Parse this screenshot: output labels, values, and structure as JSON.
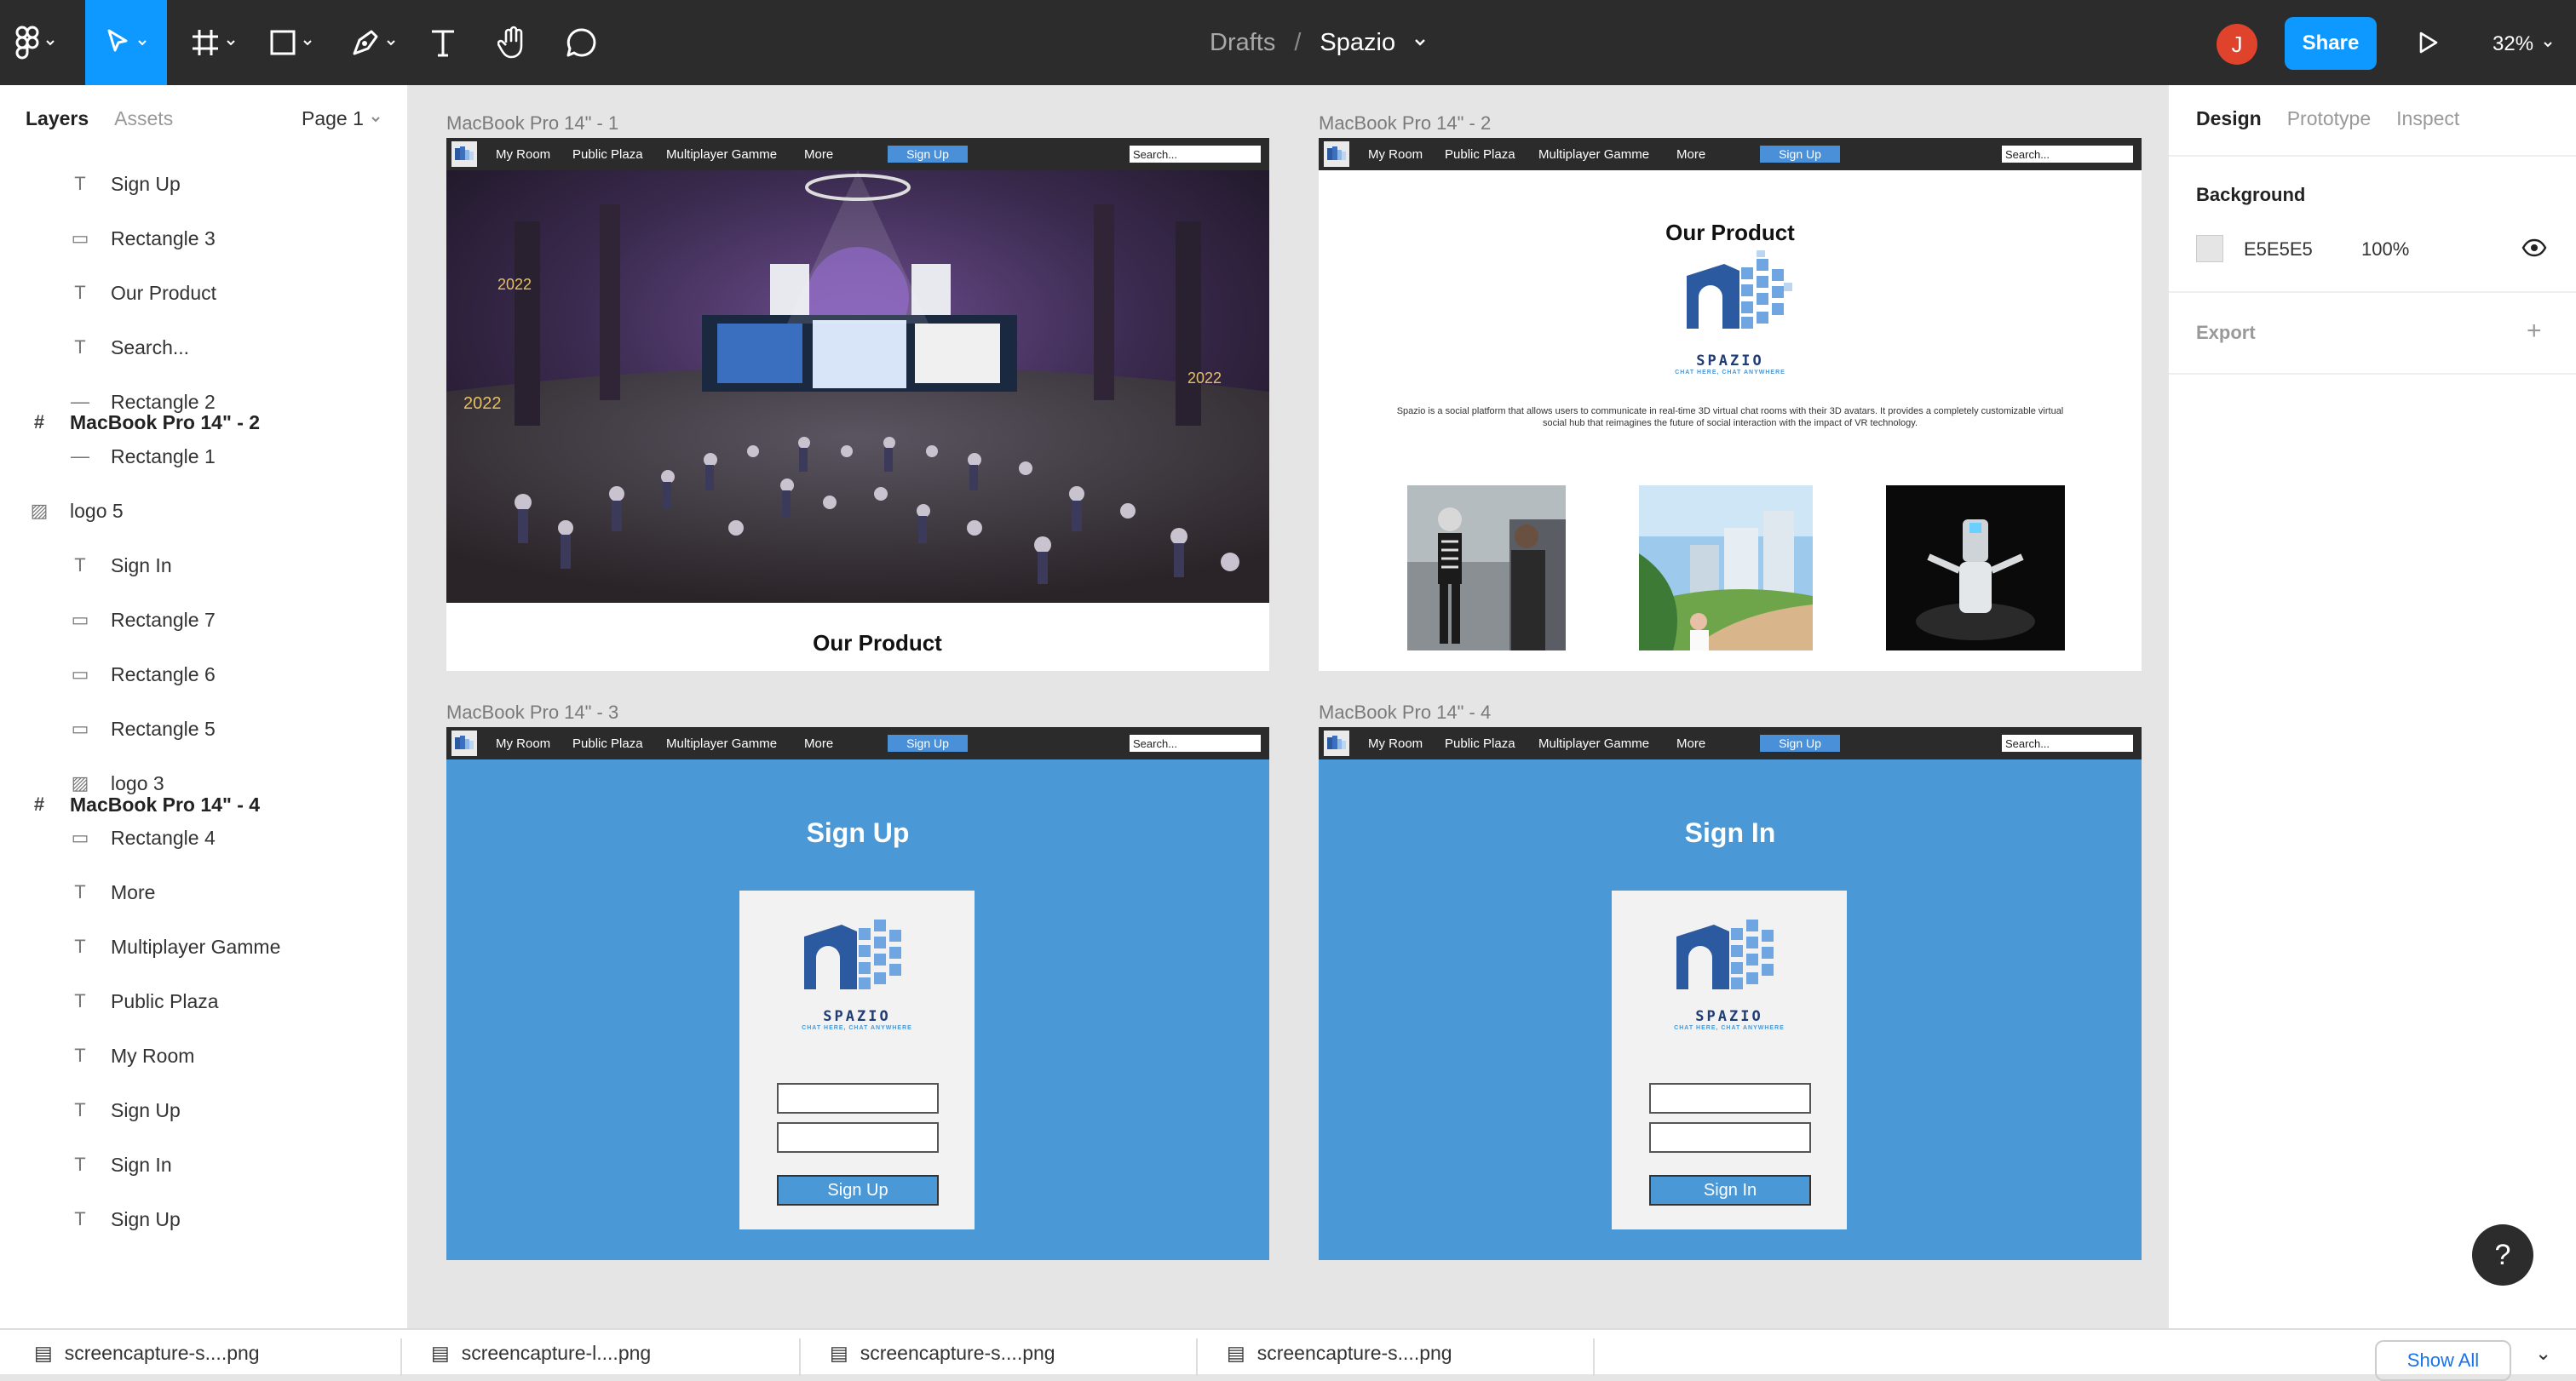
{
  "toolbar": {
    "breadcrumb_root": "Drafts",
    "breadcrumb_sep": "/",
    "file_name": "Spazio",
    "avatar_initial": "J",
    "share_label": "Share",
    "zoom": "32%"
  },
  "left_panel": {
    "tab_layers": "Layers",
    "tab_assets": "Assets",
    "page": "Page 1",
    "layers": [
      {
        "label": "MacBook Pro 14\" - 2",
        "icon": "frame-icon"
      },
      {
        "label": "Sign Up",
        "icon": "text-icon"
      },
      {
        "label": "Rectangle 3",
        "icon": "rectangle-icon"
      },
      {
        "label": "Our Product",
        "icon": "text-icon"
      },
      {
        "label": "Search...",
        "icon": "text-icon"
      },
      {
        "label": "Rectangle 2",
        "icon": "line-icon"
      },
      {
        "label": "Rectangle 1",
        "icon": "line-icon"
      },
      {
        "label": "logo 5",
        "icon": "image-icon"
      },
      {
        "label": "MacBook Pro 14\" - 4",
        "icon": "frame-icon"
      },
      {
        "label": "Sign In",
        "icon": "text-icon"
      },
      {
        "label": "Rectangle 7",
        "icon": "rectangle-icon"
      },
      {
        "label": "Rectangle 6",
        "icon": "rectangle-icon"
      },
      {
        "label": "Rectangle 5",
        "icon": "rectangle-icon"
      },
      {
        "label": "logo 3",
        "icon": "image-icon"
      },
      {
        "label": "Rectangle 4",
        "icon": "rectangle-icon"
      },
      {
        "label": "More",
        "icon": "text-icon"
      },
      {
        "label": "Multiplayer Gamme",
        "icon": "text-icon"
      },
      {
        "label": "Public Plaza",
        "icon": "text-icon"
      },
      {
        "label": "My Room",
        "icon": "text-icon"
      },
      {
        "label": "Sign Up",
        "icon": "text-icon"
      },
      {
        "label": "Sign In",
        "icon": "text-icon"
      },
      {
        "label": "Sign Up",
        "icon": "text-icon"
      }
    ]
  },
  "right_panel": {
    "tab_design": "Design",
    "tab_prototype": "Prototype",
    "tab_inspect": "Inspect",
    "background_label": "Background",
    "bg_hex": "E5E5E5",
    "bg_opacity": "100%",
    "export_label": "Export",
    "swatch_color": "#e5e5e5"
  },
  "frames": {
    "f1": {
      "label": "MacBook Pro 14\" - 1",
      "title": "Our Product"
    },
    "f2": {
      "label": "MacBook Pro 14\" - 2",
      "title": "Our Product",
      "brand": "SPAZIO",
      "tagline": "CHAT HERE, CHAT ANYWHERE",
      "description": "Spazio is a social platform that allows users to communicate in real-time 3D virtual chat rooms with their 3D avatars. It provides a completely customizable virtual social hub that reimagines the future of social interaction with the impact of VR technology."
    },
    "f3": {
      "label": "MacBook Pro 14\" - 3",
      "title": "Sign Up",
      "brand": "SPAZIO",
      "tagline": "CHAT HERE, CHAT ANYWHERE",
      "button": "Sign Up"
    },
    "f4": {
      "label": "MacBook Pro 14\" - 4",
      "title": "Sign In",
      "brand": "SPAZIO",
      "tagline": "CHAT HERE, CHAT ANYWHERE",
      "button": "Sign In"
    }
  },
  "nav": {
    "my_room": "My Room",
    "public_plaza": "Public Plaza",
    "multiplayer": "Multiplayer Gamme",
    "more": "More",
    "sign_up": "Sign Up",
    "search": "Search..."
  },
  "bottom_bar": {
    "downloads": [
      "screencapture-s....png",
      "screencapture-l....png",
      "screencapture-s....png",
      "screencapture-s....png"
    ],
    "show_all": "Show All"
  },
  "colors": {
    "accent": "#0d99ff",
    "site_blue": "#4a98d6",
    "nav_dark": "#2b2b2b"
  }
}
